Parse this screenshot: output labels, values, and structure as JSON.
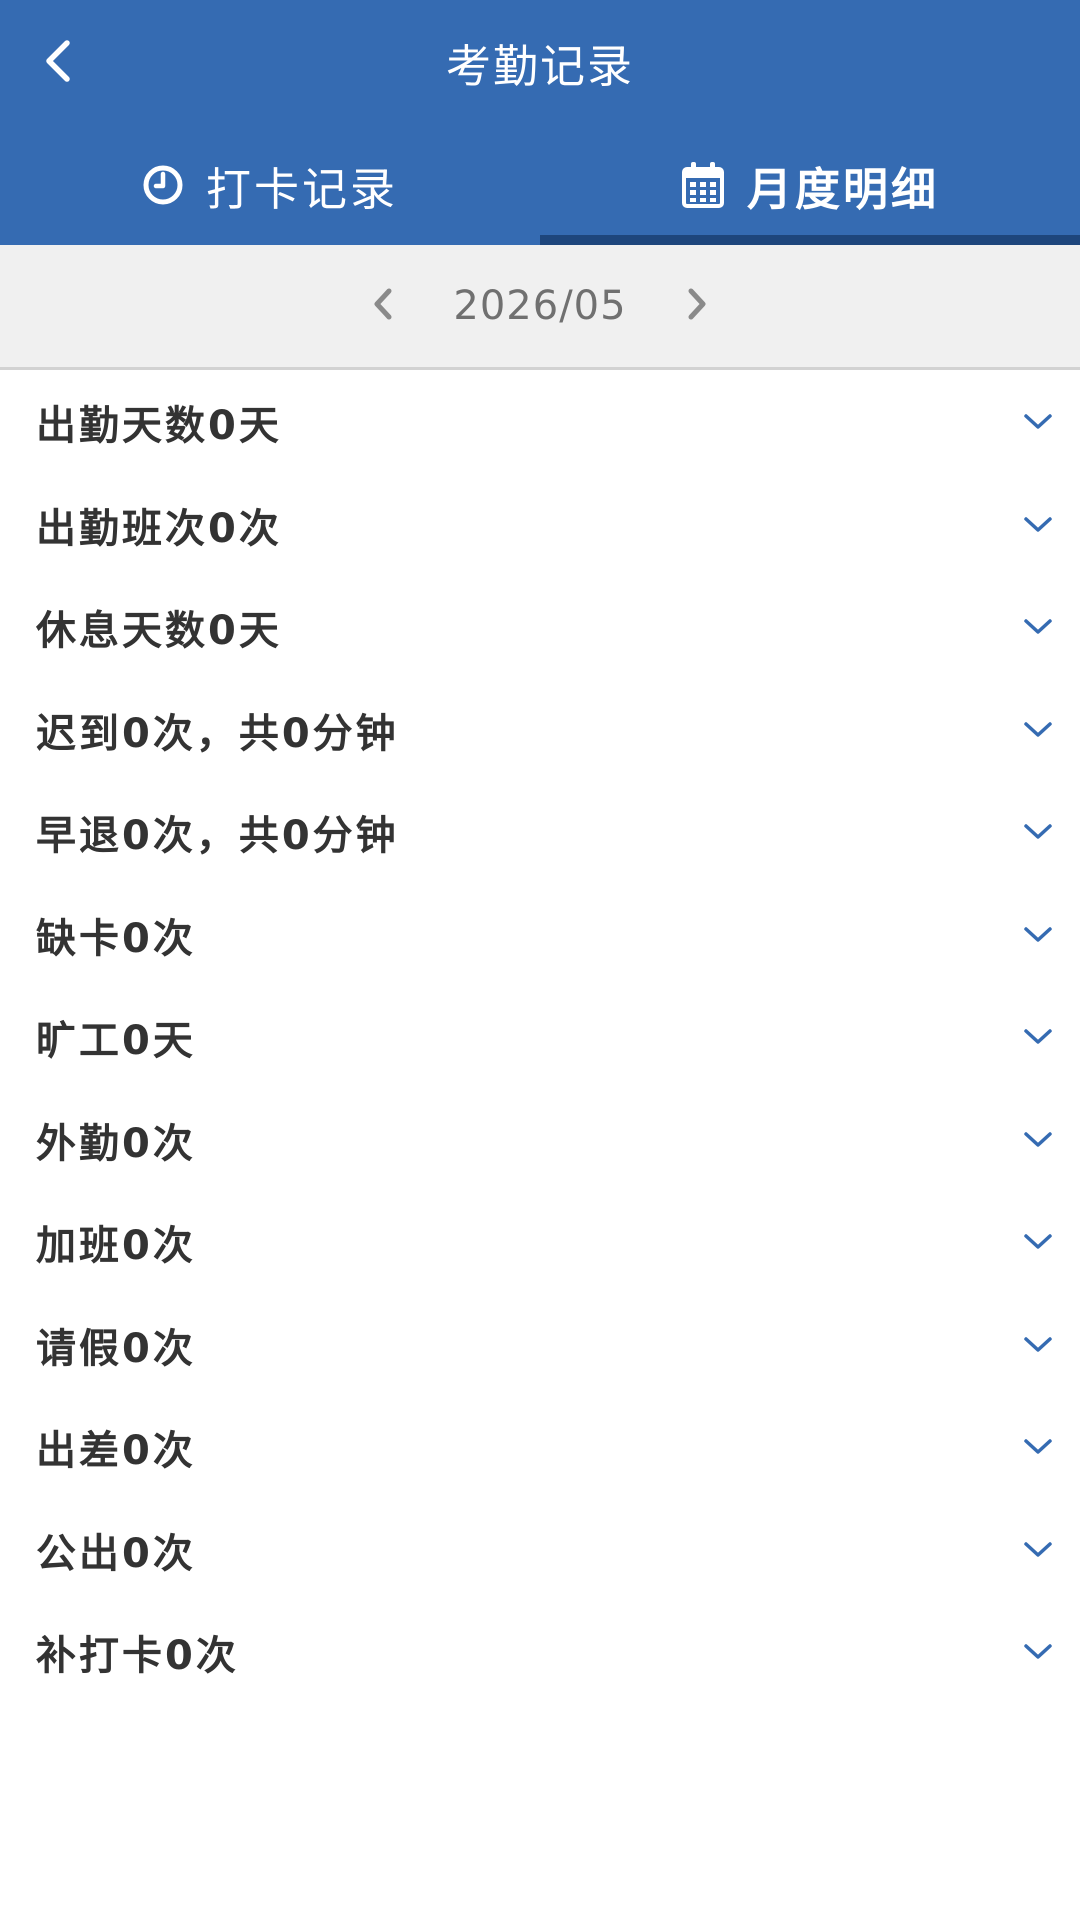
{
  "header": {
    "title": "考勤记录",
    "back_icon": "chevron-left-icon"
  },
  "tabs": [
    {
      "label": "打卡记录",
      "icon": "clock-icon",
      "active": false
    },
    {
      "label": "月度明细",
      "icon": "calendar-icon",
      "active": true
    }
  ],
  "month_nav": {
    "value": "2026/05",
    "prev_icon": "chevron-left-icon",
    "next_icon": "chevron-right-icon"
  },
  "items": [
    {
      "label": "出勤天数0天"
    },
    {
      "label": "出勤班次0次"
    },
    {
      "label": "休息天数0天"
    },
    {
      "label": "迟到0次，共0分钟"
    },
    {
      "label": "早退0次，共0分钟"
    },
    {
      "label": "缺卡0次"
    },
    {
      "label": "旷工0天"
    },
    {
      "label": "外勤0次"
    },
    {
      "label": "加班0次"
    },
    {
      "label": "请假0次"
    },
    {
      "label": "出差0次"
    },
    {
      "label": "公出0次"
    },
    {
      "label": "补打卡0次"
    }
  ],
  "colors": {
    "brand": "#356bb2",
    "indicator": "#1e467c",
    "chevron": "#356bb2",
    "text": "#333333"
  }
}
